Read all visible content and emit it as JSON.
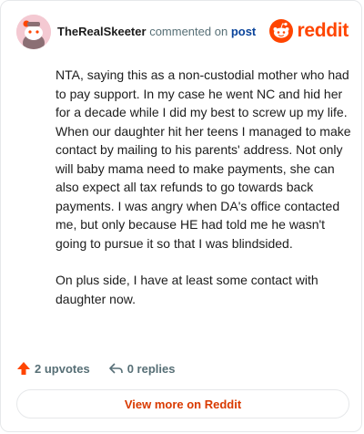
{
  "comment": {
    "username": "TheRealSkeeter",
    "action_text": "commented on",
    "post_link": "post",
    "paragraphs": [
      "NTA, saying this as a non-custodial mother who had to pay support. In my case he went NC and hid her for a decade while I did my best to screw up my life. When our daughter hit her teens I managed to make contact by mailing to his parents' address. Not only will baby mama need to make payments, she can also expect all tax refunds to go towards back payments. I was angry when DA's office contacted me, but only because HE had told me he wasn't going to pursue it so that I was blindsided.",
      "On plus side, I have at least some contact with daughter now."
    ]
  },
  "brand": {
    "name": "reddit",
    "color": "#ff4500"
  },
  "stats": {
    "upvotes": "2 upvotes",
    "replies": "0 replies"
  },
  "footer": {
    "view_more": "View more on Reddit"
  },
  "icons": {
    "avatar": "snoo-avatar-icon",
    "logo": "reddit-logo-icon",
    "upvote": "upvote-arrow-icon",
    "reply": "reply-arrow-icon"
  }
}
